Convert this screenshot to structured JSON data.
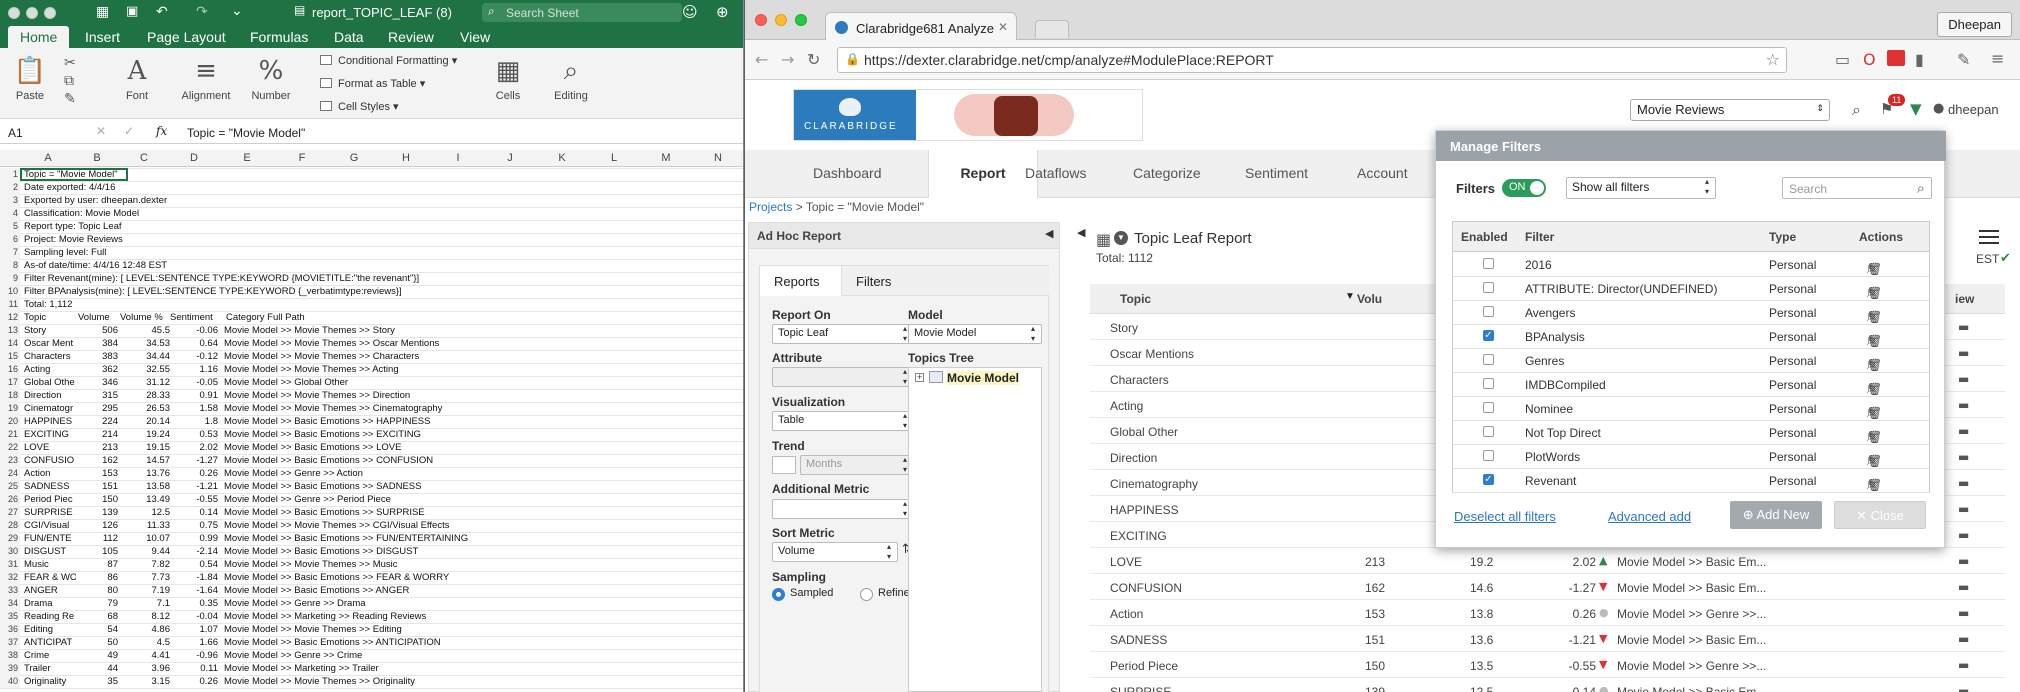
{
  "excel": {
    "title": "report_TOPIC_LEAF (8)",
    "search_placeholder": "Search Sheet",
    "tabs": [
      "Home",
      "Insert",
      "Page Layout",
      "Formulas",
      "Data",
      "Review",
      "View"
    ],
    "ribbon": {
      "paste": "Paste",
      "font": "Font",
      "alignment": "Alignment",
      "number": "Number",
      "number_symbol": "%",
      "conditional": "Conditional Formatting",
      "format_table": "Format as Table",
      "cell_styles": "Cell Styles",
      "cells": "Cells",
      "editing": "Editing"
    },
    "name_box": "A1",
    "formula": "Topic = \"Movie Model\"",
    "fx": "fx",
    "columns": [
      "A",
      "B",
      "C",
      "D",
      "E",
      "F",
      "G",
      "H",
      "I",
      "J",
      "K",
      "L",
      "M",
      "N"
    ],
    "meta_rows": [
      "Topic = \"Movie Model\"",
      "Date exported: 4/4/16",
      "Exported by user: dheepan.dexter",
      "Classification: Movie Model",
      "Report type: Topic Leaf",
      "Project: Movie Reviews",
      "Sampling level: Full",
      "As-of date/time: 4/4/16 12:48 EST",
      "Filter Revenant(mine):  [ LEVEL:SENTENCE TYPE:KEYWORD {MOVIETITLE:\"the revenant\"}]",
      "Filter BPAnalysis(mine):  [ LEVEL:SENTENCE TYPE:KEYWORD {_verbatimtype:reviews}]",
      "Total: 1,112"
    ],
    "header_row": [
      "Topic",
      "Volume",
      "Volume %",
      "Sentiment",
      "Category Full Path"
    ],
    "data_rows": [
      [
        "Story",
        "506",
        "45.5",
        "-0.06",
        "Movie Model >> Movie Themes >> Story"
      ],
      [
        "Oscar Ment",
        "384",
        "34.53",
        "0.64",
        "Movie Model >> Movie Themes >> Oscar Mentions"
      ],
      [
        "Characters",
        "383",
        "34.44",
        "-0.12",
        "Movie Model >> Movie Themes >> Characters"
      ],
      [
        "Acting",
        "362",
        "32.55",
        "1.16",
        "Movie Model >> Movie Themes >> Acting"
      ],
      [
        "Global Othe",
        "346",
        "31.12",
        "-0.05",
        "Movie Model >> Global Other"
      ],
      [
        "Direction",
        "315",
        "28.33",
        "0.91",
        "Movie Model >> Movie Themes >> Direction"
      ],
      [
        "Cinematogr",
        "295",
        "26.53",
        "1.58",
        "Movie Model >> Movie Themes >> Cinematography"
      ],
      [
        "HAPPINES",
        "224",
        "20.14",
        "1.8",
        "Movie Model >> Basic Emotions >> HAPPINESS"
      ],
      [
        "EXCITING",
        "214",
        "19.24",
        "0.53",
        "Movie Model >> Basic Emotions >> EXCITING"
      ],
      [
        "LOVE",
        "213",
        "19.15",
        "2.02",
        "Movie Model >> Basic Emotions >> LOVE"
      ],
      [
        "CONFUSIO",
        "162",
        "14.57",
        "-1.27",
        "Movie Model >> Basic Emotions >> CONFUSION"
      ],
      [
        "Action",
        "153",
        "13.76",
        "0.26",
        "Movie Model >> Genre >> Action"
      ],
      [
        "SADNESS",
        "151",
        "13.58",
        "-1.21",
        "Movie Model >> Basic Emotions >> SADNESS"
      ],
      [
        "Period Piec",
        "150",
        "13.49",
        "-0.55",
        "Movie Model >> Genre >> Period Piece"
      ],
      [
        "SURPRISE",
        "139",
        "12.5",
        "0.14",
        "Movie Model >> Basic Emotions >> SURPRISE"
      ],
      [
        "CGI/Visual",
        "126",
        "11.33",
        "0.75",
        "Movie Model >> Movie Themes >> CGI/Visual Effects"
      ],
      [
        "FUN/ENTE",
        "112",
        "10.07",
        "0.99",
        "Movie Model >> Basic Emotions >> FUN/ENTERTAINING"
      ],
      [
        "DISGUST",
        "105",
        "9.44",
        "-2.14",
        "Movie Model >> Basic Emotions >> DISGUST"
      ],
      [
        "Music",
        "87",
        "7.82",
        "0.54",
        "Movie Model >> Movie Themes >> Music"
      ],
      [
        "FEAR & WO",
        "86",
        "7.73",
        "-1.84",
        "Movie Model >> Basic Emotions >> FEAR & WORRY"
      ],
      [
        "ANGER",
        "80",
        "7.19",
        "-1.64",
        "Movie Model >> Basic Emotions >> ANGER"
      ],
      [
        "Drama",
        "79",
        "7.1",
        "0.35",
        "Movie Model >> Genre >> Drama"
      ],
      [
        "Reading Re",
        "68",
        "8.12",
        "-0.04",
        "Movie Model >> Marketing >> Reading Reviews"
      ],
      [
        "Editing",
        "54",
        "4.86",
        "1.07",
        "Movie Model >> Movie Themes >> Editing"
      ],
      [
        "ANTICIPAT",
        "50",
        "4.5",
        "1.66",
        "Movie Model >> Basic Emotions >> ANTICIPATION"
      ],
      [
        "Crime",
        "49",
        "4.41",
        "-0.96",
        "Movie Model >> Genre >> Crime"
      ],
      [
        "Trailer",
        "44",
        "3.96",
        "0.11",
        "Movie Model >> Marketing >> Trailer"
      ],
      [
        "Originality",
        "35",
        "3.15",
        "0.26",
        "Movie Model >> Movie Themes >> Originality"
      ]
    ]
  },
  "browser": {
    "tab_title": "Clarabridge681 Analyze",
    "user_button": "Dheepan",
    "url": "https://dexter.clarabridge.net/cmp/analyze#ModulePlace:REPORT"
  },
  "app": {
    "logo_text": "CLARABRIDGE",
    "project_select": "Movie Reviews",
    "notification_count": "11",
    "user": "dheepan",
    "nav": [
      "Dashboard",
      "Report",
      "Dataflows",
      "Categorize",
      "Sentiment",
      "Account"
    ],
    "breadcrumb_link": "Projects",
    "breadcrumb_rest": "> Topic = \"Movie Model\"",
    "adhoc": {
      "title": "Ad Hoc Report",
      "tab_reports": "Reports",
      "tab_filters": "Filters",
      "report_on_label": "Report On",
      "report_on": "Topic Leaf",
      "model_label": "Model",
      "model": "Movie Model",
      "attribute_label": "Attribute",
      "topics_tree_label": "Topics Tree",
      "tree_root": "Movie Model",
      "visualization_label": "Visualization",
      "visualization": "Table",
      "trend_label": "Trend",
      "trend": "Months",
      "additional_metric_label": "Additional Metric",
      "sort_metric_label": "Sort Metric",
      "sort_metric": "Volume",
      "sampling_label": "Sampling",
      "sampled": "Sampled",
      "refined": "Refined"
    },
    "report": {
      "title": "Topic Leaf Report",
      "total": "Total: 1112",
      "col_topic": "Topic",
      "col_volume": "Volu",
      "col_view": "iew",
      "est": "EST",
      "rows": [
        {
          "topic": "Story"
        },
        {
          "topic": "Oscar Mentions"
        },
        {
          "topic": "Characters"
        },
        {
          "topic": "Acting"
        },
        {
          "topic": "Global Other"
        },
        {
          "topic": "Direction"
        },
        {
          "topic": "Cinematography"
        },
        {
          "topic": "HAPPINESS"
        },
        {
          "topic": "EXCITING"
        },
        {
          "topic": "LOVE",
          "volume": "213",
          "pct": "19.2",
          "sent": "2.02",
          "path": "Movie Model >> Basic Em..."
        },
        {
          "topic": "CONFUSION",
          "volume": "162",
          "pct": "14.6",
          "sent": "-1.27",
          "path": "Movie Model >> Basic Em..."
        },
        {
          "topic": "Action",
          "volume": "153",
          "pct": "13.8",
          "sent": "0.26",
          "path": "Movie Model >> Genre >>..."
        },
        {
          "topic": "SADNESS",
          "volume": "151",
          "pct": "13.6",
          "sent": "-1.21",
          "path": "Movie Model >> Basic Em..."
        },
        {
          "topic": "Period Piece",
          "volume": "150",
          "pct": "13.5",
          "sent": "-0.55",
          "path": "Movie Model >> Genre >>..."
        },
        {
          "topic": "SURPRISE",
          "volume": "139",
          "pct": "12.5",
          "sent": "0.14",
          "path": "Movie Model >> Basic Em..."
        }
      ]
    },
    "filters": {
      "title": "Manage Filters",
      "filters_label": "Filters",
      "toggle": "ON",
      "show_select": "Show all filters",
      "search_placeholder": "Search",
      "col_enabled": "Enabled",
      "col_filter": "Filter",
      "col_type": "Type",
      "col_actions": "Actions",
      "rows": [
        {
          "name": "2016",
          "type": "Personal",
          "enabled": false
        },
        {
          "name": "ATTRIBUTE: Director(UNDEFINED)",
          "type": "Personal",
          "enabled": false
        },
        {
          "name": "Avengers",
          "type": "Personal",
          "enabled": false
        },
        {
          "name": "BPAnalysis",
          "type": "Personal",
          "enabled": true
        },
        {
          "name": "Genres",
          "type": "Personal",
          "enabled": false
        },
        {
          "name": "IMDBCompiled",
          "type": "Personal",
          "enabled": false
        },
        {
          "name": "Nominee",
          "type": "Personal",
          "enabled": false
        },
        {
          "name": "Not Top Direct",
          "type": "Personal",
          "enabled": false
        },
        {
          "name": "PlotWords",
          "type": "Personal",
          "enabled": false
        },
        {
          "name": "Revenant",
          "type": "Personal",
          "enabled": true
        }
      ],
      "deselect_all": "Deselect all filters",
      "advanced_add": "Advanced add",
      "add_new": "Add New",
      "close": "Close"
    }
  }
}
